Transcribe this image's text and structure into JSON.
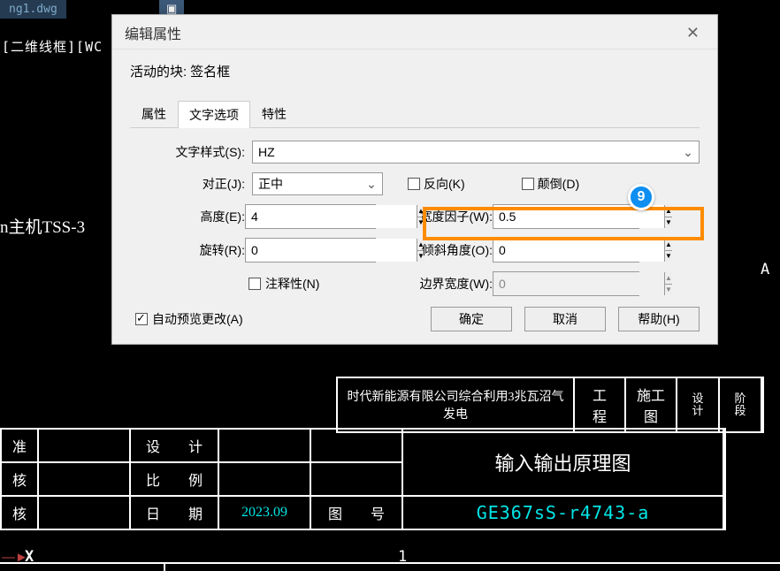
{
  "background": {
    "tab1": "ng1.dwg",
    "tab2_prefix": "▣",
    "viewport_label": "[二维线框][WC",
    "text1": "n主机TSS-3"
  },
  "dialog": {
    "title": "编辑属性",
    "block_prefix": "活动的块:",
    "block_name": "签名框",
    "tabs": {
      "t1": "属性",
      "t2": "文字选项",
      "t3": "特性"
    },
    "labels": {
      "textstyle": "文字样式(S):",
      "justify": "对正(J):",
      "reverse": "反向(K)",
      "upside": "颠倒(D)",
      "height": "高度(E):",
      "widthfactor": "宽度因子(W):",
      "rotation": "旋转(R):",
      "oblique": "倾斜角度(O):",
      "annotative": "注释性(N)",
      "boundary": "边界宽度(W):",
      "autopreview": "自动预览更改(A)"
    },
    "values": {
      "textstyle": "HZ",
      "justify": "正中",
      "height": "4",
      "widthfactor": "0.5",
      "rotation": "0",
      "oblique": "0",
      "boundary": "0"
    },
    "buttons": {
      "ok": "确定",
      "cancel": "取消",
      "help": "帮助(H)"
    }
  },
  "badge": "9",
  "drawing": {
    "title_long": "时代新能源有限公司综合利用3兆瓦沼气发电",
    "proj": "工　程",
    "constr": "施工图",
    "design_lbl": "设　计",
    "stage_lbl": "阶　段",
    "row1a": "准",
    "row1b": "设　　计",
    "row2a": "核",
    "row2b": "比　　例",
    "row3a": "核",
    "row3b": "日　　期",
    "row3c": "2023.09",
    "row3d": "图　　号",
    "center_title": "输入输出原理图",
    "dwgno": "GE367sS-r4743-a",
    "axis_a": "A",
    "axis_x": "X",
    "axis_1": "1"
  }
}
